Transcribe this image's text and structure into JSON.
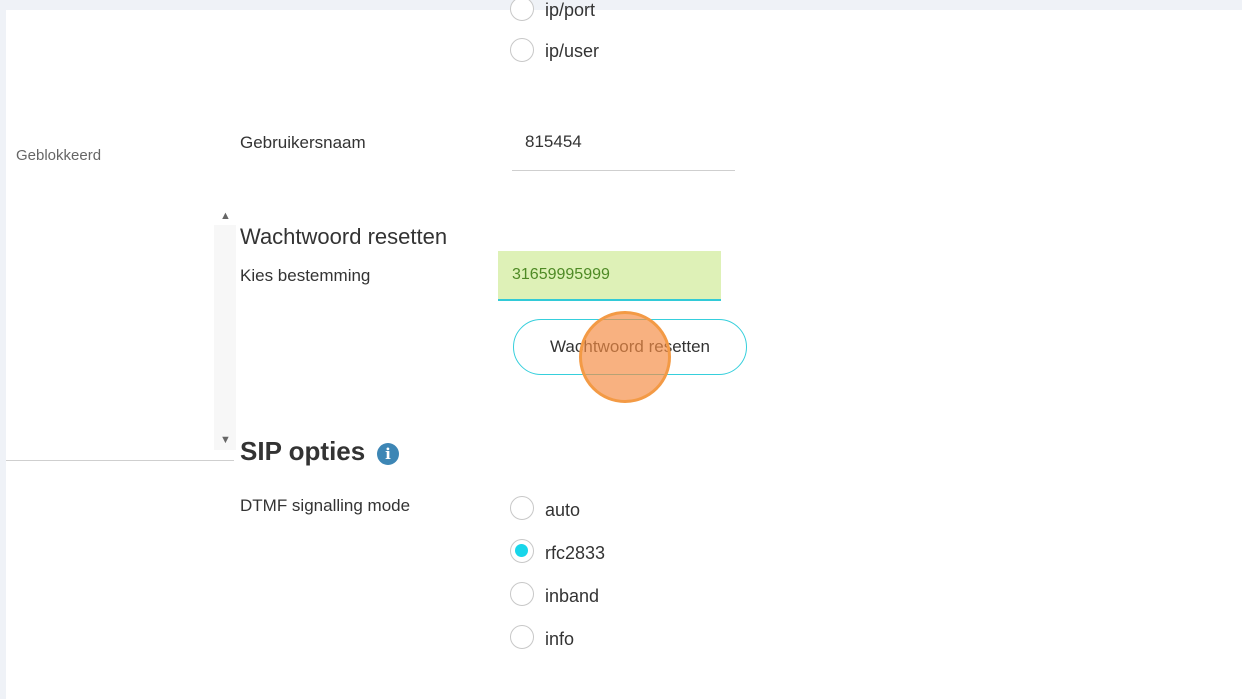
{
  "sidebar": {
    "status_label": "Geblokkeerd"
  },
  "auth_type": {
    "options": [
      {
        "label": "ip/port",
        "checked": false
      },
      {
        "label": "ip/user",
        "checked": false
      }
    ]
  },
  "username": {
    "label": "Gebruikersnaam",
    "value": "815454"
  },
  "password_reset": {
    "title": "Wachtwoord resetten",
    "destination_label": "Kies bestemming",
    "destination_value": "31659995999",
    "button_label": "Wachtwoord resetten"
  },
  "sip_options": {
    "title": "SIP opties",
    "info_icon": "info-icon",
    "dtmf_label": "DTMF signalling mode",
    "dtmf_options": [
      {
        "label": "auto",
        "checked": false
      },
      {
        "label": "rfc2833",
        "checked": true
      },
      {
        "label": "inband",
        "checked": false
      },
      {
        "label": "info",
        "checked": false
      }
    ]
  },
  "colors": {
    "accent": "#18d6ea",
    "input_highlight": "#def1b7",
    "click_marker": "#f39a45",
    "info_blue": "#3d86b5"
  }
}
